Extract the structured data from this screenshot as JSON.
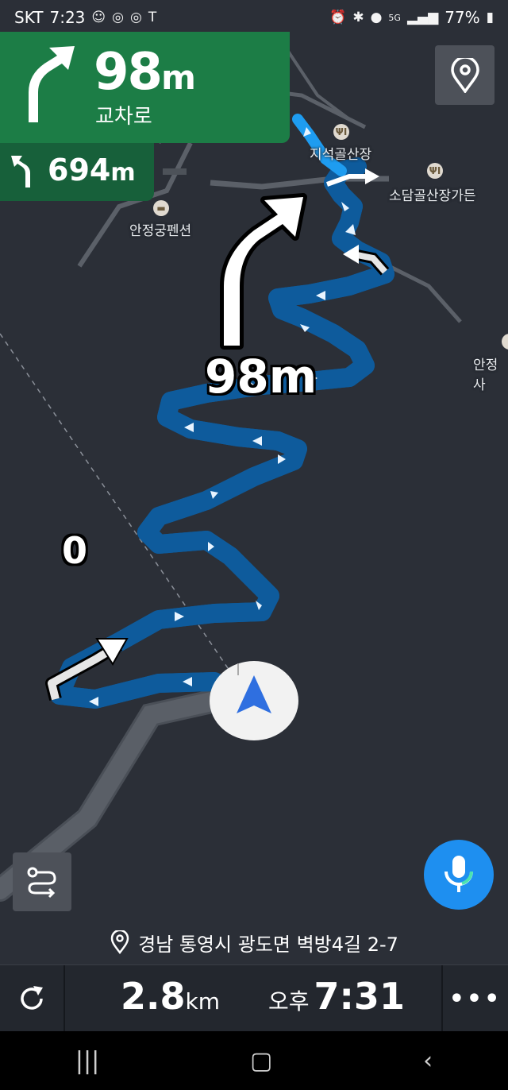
{
  "status_bar": {
    "carrier": "SKT",
    "time": "7:23",
    "battery": "77%",
    "icons": [
      "emoji-icon",
      "instagram-icon",
      "instagram-icon",
      "t-icon",
      "alarm-icon",
      "bluetooth-icon",
      "location-icon",
      "5g-icon",
      "signal-icon",
      "battery-icon"
    ]
  },
  "guidance": {
    "distance_value": "98",
    "distance_unit": "m",
    "road_name": "교차로",
    "next_distance_value": "694",
    "next_distance_unit": "m"
  },
  "map": {
    "pois": [
      {
        "name": "지석골산장",
        "icon": "restaurant-icon"
      },
      {
        "name": "소담골산장가든",
        "icon": "restaurant-icon"
      },
      {
        "name": "안정궁펜션",
        "icon": "bed-icon"
      },
      {
        "name": "안정사",
        "icon": "place-icon"
      }
    ],
    "overlay_distance": "98m",
    "speed_readout": "0"
  },
  "address": "경남 통영시 광도면 벽방4길 2-7",
  "trip": {
    "remaining_value": "2.8",
    "remaining_unit": "km",
    "eta_ampm": "오후",
    "eta_time": "7:31"
  },
  "colors": {
    "route": "#1e9cf0",
    "guidance_green": "#1c7d46",
    "next_green": "#17603a",
    "map_bg": "#2b2f37"
  }
}
